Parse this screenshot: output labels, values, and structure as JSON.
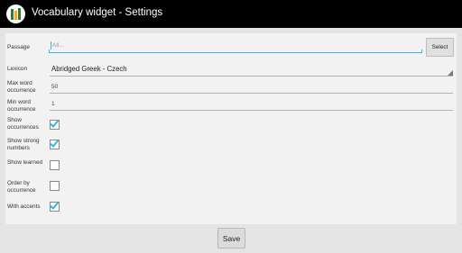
{
  "titlebar": {
    "title": "Vocabulary widget - Settings",
    "icon": "books-app-icon"
  },
  "form": {
    "passage": {
      "label": "Passage",
      "placeholder": "All...",
      "select_label": "Select"
    },
    "lexicon": {
      "label": "Lexicon",
      "value": "Abridged Greek - Czech"
    },
    "max_word": {
      "label": "Max word occurrence",
      "value": "50"
    },
    "min_word": {
      "label": "Min word occurrence",
      "value": "1"
    },
    "show_occurrences": {
      "label": "Show occurrences",
      "checked": true
    },
    "show_strong": {
      "label": "Show strong numbers",
      "checked": true
    },
    "show_learned": {
      "label": "Show learned",
      "checked": false
    },
    "order_by": {
      "label": "Order by occurrence",
      "checked": false
    },
    "with_accents": {
      "label": "With accents",
      "checked": true
    }
  },
  "footer": {
    "save_label": "Save"
  },
  "colors": {
    "accent": "#33b5e5",
    "titlebar": "#000000",
    "background": "#e4e4e4"
  }
}
